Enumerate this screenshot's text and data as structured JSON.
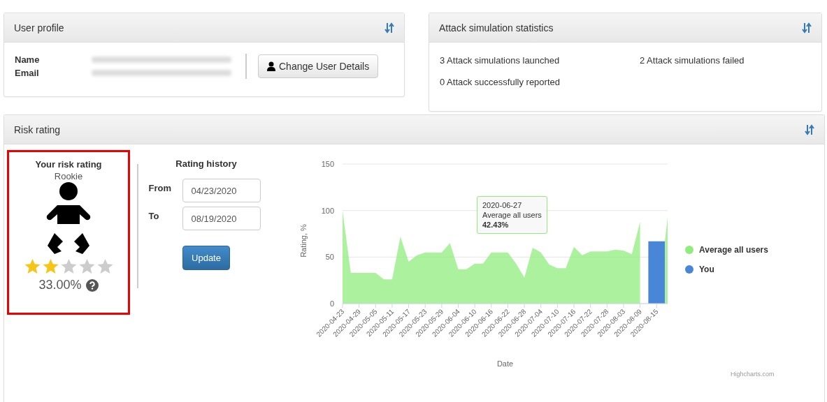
{
  "user_profile": {
    "title": "User profile",
    "fields": [
      {
        "label": "Name"
      },
      {
        "label": "Email"
      }
    ],
    "button": "Change User Details"
  },
  "attack_statistics": {
    "title": "Attack simulation statistics",
    "items": [
      "3 Attack simulations launched",
      "2 Attack simulations failed",
      "0 Attack successfully reported"
    ]
  },
  "risk_rating": {
    "title": "Risk rating",
    "your_rating": {
      "title": "Your risk rating",
      "level_name": "Rookie",
      "stars": 2,
      "percent": "33.00%"
    },
    "history": {
      "title": "Rating history",
      "from_label": "From",
      "from_value": "04/23/2020",
      "to_label": "To",
      "to_value": "08/19/2020",
      "button": "Update"
    },
    "tooltip": {
      "date": "2020-06-27",
      "series": "Average all users",
      "value": "42.43%"
    },
    "credit": "Highcharts.com",
    "chart_data": {
      "type": "area",
      "xlabel": "Date",
      "ylabel": "Rating, %",
      "x": [
        "2020-04-23",
        "2020-04-26",
        "2020-04-29",
        "2020-05-02",
        "2020-05-05",
        "2020-05-08",
        "2020-05-11",
        "2020-05-14",
        "2020-05-17",
        "2020-05-20",
        "2020-05-23",
        "2020-05-26",
        "2020-05-29",
        "2020-06-01",
        "2020-06-04",
        "2020-06-07",
        "2020-06-10",
        "2020-06-13",
        "2020-06-16",
        "2020-06-19",
        "2020-06-22",
        "2020-06-25",
        "2020-06-28",
        "2020-07-01",
        "2020-07-04",
        "2020-07-07",
        "2020-07-10",
        "2020-07-13",
        "2020-07-16",
        "2020-07-19",
        "2020-07-22",
        "2020-07-25",
        "2020-07-28",
        "2020-07-31",
        "2020-08-03",
        "2020-08-06",
        "2020-08-09",
        "2020-08-12",
        "2020-08-15",
        "2020-08-18",
        "2020-08-19"
      ],
      "series": [
        {
          "name": "Average all users",
          "color": "#90ed7d",
          "values": [
            100,
            33,
            33,
            33,
            33,
            26,
            26,
            72,
            45,
            52,
            55,
            55,
            55,
            65,
            37,
            37,
            43,
            43,
            55,
            55,
            55,
            43,
            28,
            60,
            55,
            42,
            38,
            38,
            61,
            52,
            56,
            56,
            56,
            58,
            57,
            53,
            88,
            null,
            null,
            67,
            93
          ]
        },
        {
          "name": "You",
          "color": "#4a86d8",
          "values": [
            null,
            null,
            null,
            null,
            null,
            null,
            null,
            null,
            null,
            null,
            null,
            null,
            null,
            null,
            null,
            null,
            null,
            null,
            null,
            null,
            null,
            null,
            null,
            null,
            null,
            null,
            null,
            null,
            null,
            null,
            null,
            null,
            null,
            null,
            null,
            null,
            null,
            67,
            67,
            67,
            null
          ]
        }
      ],
      "xlim": [
        "2020-04-23",
        "2020-08-19"
      ],
      "ylim": [
        0,
        150
      ],
      "yticks": [
        0,
        50,
        100,
        150
      ],
      "xticks": [
        "2020-04-23",
        "2020-04-29",
        "2020-05-05",
        "2020-05-11",
        "2020-05-17",
        "2020-05-23",
        "2020-05-29",
        "2020-06-04",
        "2020-06-10",
        "2020-06-16",
        "2020-06-22",
        "2020-06-28",
        "2020-07-04",
        "2020-07-10",
        "2020-07-16",
        "2020-07-22",
        "2020-07-28",
        "2020-08-03",
        "2020-08-09",
        "2020-08-15"
      ]
    }
  }
}
